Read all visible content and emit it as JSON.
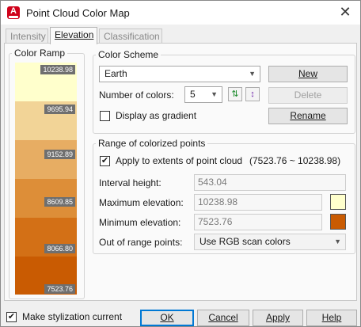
{
  "window": {
    "title": "Point Cloud Color Map"
  },
  "tabs": [
    {
      "label": "Intensity",
      "active": false
    },
    {
      "label": "Elevation",
      "active": true
    },
    {
      "label": "Classification",
      "active": false
    }
  ],
  "color_ramp": {
    "legend": "Color Ramp",
    "segments": [
      {
        "color": "#ffffcc",
        "label": "10238.98"
      },
      {
        "color": "#f2d497",
        "label": "9695.94"
      },
      {
        "color": "#e7ad63",
        "label": "9152.89"
      },
      {
        "color": "#dd8e38",
        "label": "8609.85"
      },
      {
        "color": "#d37016",
        "label": "8066.80"
      },
      {
        "color": "#c95b02",
        "label": "7523.76"
      }
    ]
  },
  "color_scheme": {
    "legend": "Color Scheme",
    "scheme_value": "Earth",
    "num_colors_label": "Number of colors:",
    "num_colors_value": "5",
    "display_gradient_label": "Display as gradient",
    "display_gradient_checked": false,
    "new_label": "New",
    "delete_label": "Delete",
    "rename_label": "Rename"
  },
  "range": {
    "legend": "Range of colorized points",
    "apply_label": "Apply to extents of point cloud",
    "apply_range": "(7523.76 ~ 10238.98)",
    "apply_checked": true,
    "interval_label": "Interval height:",
    "interval_value": "543.04",
    "max_label": "Maximum elevation:",
    "max_value": "10238.98",
    "max_color": "#ffffcc",
    "min_label": "Minimum elevation:",
    "min_value": "7523.76",
    "min_color": "#c95b02",
    "out_of_range_label": "Out of range points:",
    "out_of_range_value": "Use RGB scan colors"
  },
  "footer": {
    "make_current_label": "Make stylization current",
    "make_current_checked": true,
    "ok_label": "OK",
    "cancel_label": "Cancel",
    "apply_label": "Apply",
    "help_label": "Help"
  }
}
